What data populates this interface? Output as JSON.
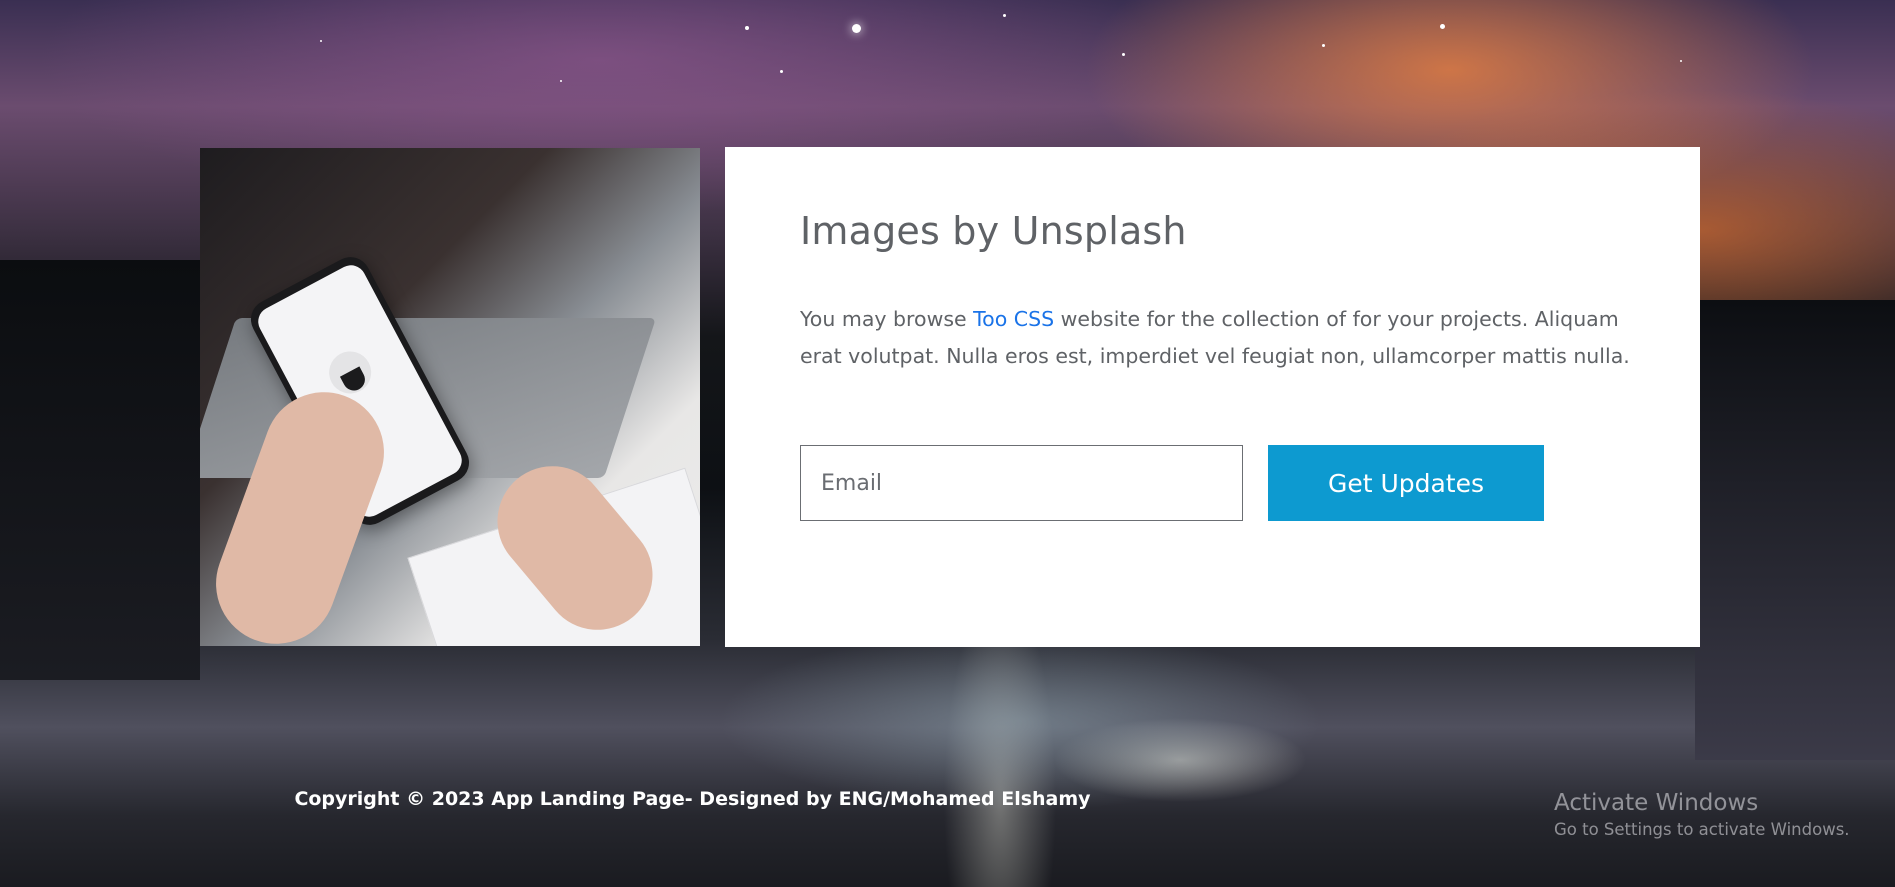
{
  "card": {
    "title": "Images by Unsplash",
    "text_before_link": "You may browse ",
    "link_label": "Too CSS",
    "text_after_link": " website for the collection of for your projects. Aliquam erat volutpat. Nulla eros est, imperdiet vel feugiat non, ullamcorper mattis nulla.",
    "email_placeholder": "Email",
    "email_value": "",
    "submit_label": "Get Updates"
  },
  "footer": {
    "copyright": "Copyright © 2023 App Landing Page- Designed by ENG/Mohamed Elshamy"
  },
  "os_watermark": {
    "title": "Activate Windows",
    "subtitle": "Go to Settings to activate Windows."
  },
  "colors": {
    "accent": "#0d9ad0",
    "link": "#1a73e8",
    "text": "#5f6266",
    "card_bg": "#ffffff"
  },
  "icons": [
    "background-night-sky-photo",
    "phone-laptop-photo"
  ]
}
